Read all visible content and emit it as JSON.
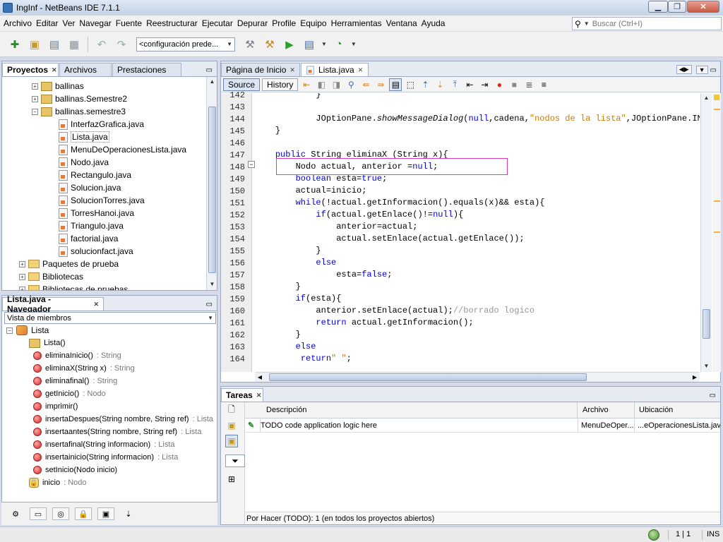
{
  "window": {
    "title": "IngInf - NetBeans IDE 7.1.1"
  },
  "menu": [
    "Archivo",
    "Editar",
    "Ver",
    "Navegar",
    "Fuente",
    "Reestructurar",
    "Ejecutar",
    "Depurar",
    "Profile",
    "Equipo",
    "Herramientas",
    "Ventana",
    "Ayuda"
  ],
  "search": {
    "placeholder": "Buscar (Ctrl+I)"
  },
  "toolbar": {
    "config": "<configuración prede..."
  },
  "projects": {
    "tabs": [
      "Proyectos",
      "Archivos",
      "Prestaciones"
    ],
    "tree": [
      "ballinas",
      "ballinas.Semestre2",
      "ballinas.semestre3",
      "InterfazGrafica.java",
      "Lista.java",
      "MenuDeOperacionesLista.java",
      "Nodo.java",
      "Rectangulo.java",
      "Solucion.java",
      "SolucionTorres.java",
      "TorresHanoi.java",
      "Triangulo.java",
      "factorial.java",
      "solucionfact.java",
      "Paquetes de prueba",
      "Bibliotecas",
      "Bibliotecas de pruebas"
    ]
  },
  "navigator": {
    "title": "Lista.java - Navegador",
    "filter": "Vista de miembros",
    "root": "Lista",
    "members": [
      {
        "name": "Lista()",
        "type": ""
      },
      {
        "name": "eliminaInicio()",
        "type": " : String"
      },
      {
        "name": "eliminaX(String x)",
        "type": " : String"
      },
      {
        "name": "eliminafinal()",
        "type": " : String"
      },
      {
        "name": "getInicio()",
        "type": " : Nodo"
      },
      {
        "name": "imprimir()",
        "type": ""
      },
      {
        "name": "insertaDespues(String nombre, String ref)",
        "type": " : Lista"
      },
      {
        "name": "insertaantes(String nombre, String ref)",
        "type": " : Lista"
      },
      {
        "name": "insertafinal(String informacion)",
        "type": " : Lista"
      },
      {
        "name": "insertainicio(String informacion)",
        "type": " : Lista"
      },
      {
        "name": "setInicio(Nodo inicio)",
        "type": ""
      },
      {
        "name": "inicio",
        "type": " : Nodo"
      }
    ]
  },
  "editor": {
    "tabs": [
      "Página de Inicio",
      "Lista.java"
    ],
    "modes": [
      "Source",
      "History"
    ],
    "line_numbers": [
      "142",
      "143",
      "144",
      "145",
      "146",
      "147",
      "148",
      "149",
      "150",
      "151",
      "152",
      "153",
      "154",
      "155",
      "156",
      "157",
      "158",
      "159",
      "160",
      "161",
      "162",
      "163",
      "164"
    ],
    "lines": [
      {
        "indent": "            ",
        "parts": [
          [
            "",
            "}"
          ]
        ]
      },
      {
        "indent": "",
        "parts": [
          [
            "",
            ""
          ]
        ]
      },
      {
        "indent": "            ",
        "parts": [
          [
            "",
            "JOptionPane."
          ],
          [
            "it",
            "showMessageDialog"
          ],
          [
            "",
            "("
          ],
          [
            "kw",
            "null"
          ],
          [
            "",
            ",cadena,"
          ],
          [
            "str",
            "\"nodos de la lista\""
          ],
          [
            "",
            ",JOptionPane.INFORMATION_MESSAGE);"
          ]
        ]
      },
      {
        "indent": "    ",
        "parts": [
          [
            "",
            "}"
          ]
        ]
      },
      {
        "indent": "",
        "parts": [
          [
            "",
            ""
          ]
        ]
      },
      {
        "indent": "    ",
        "parts": [
          [
            "kw",
            "public"
          ],
          [
            "",
            " String eliminaX (String x){"
          ]
        ]
      },
      {
        "indent": "        ",
        "parts": [
          [
            "",
            "Nodo actual, anterior ="
          ],
          [
            "kw",
            "null"
          ],
          [
            "",
            ";"
          ]
        ]
      },
      {
        "indent": "        ",
        "parts": [
          [
            "kw",
            "boolean"
          ],
          [
            "",
            " esta="
          ],
          [
            "kw",
            "true"
          ],
          [
            "",
            ";"
          ]
        ]
      },
      {
        "indent": "        ",
        "parts": [
          [
            "",
            "actual=inicio;"
          ]
        ]
      },
      {
        "indent": "        ",
        "parts": [
          [
            "kw",
            "while"
          ],
          [
            "",
            "(!actual.getInformacion().equals(x)&& esta){"
          ]
        ]
      },
      {
        "indent": "            ",
        "parts": [
          [
            "kw",
            "if"
          ],
          [
            "",
            "(actual.getEnlace()!="
          ],
          [
            "kw",
            "null"
          ],
          [
            "",
            "){"
          ]
        ]
      },
      {
        "indent": "                ",
        "parts": [
          [
            "",
            "anterior=actual;"
          ]
        ]
      },
      {
        "indent": "                ",
        "parts": [
          [
            "",
            "actual.setEnlace(actual.getEnlace());"
          ]
        ]
      },
      {
        "indent": "            ",
        "parts": [
          [
            "",
            "}"
          ]
        ]
      },
      {
        "indent": "            ",
        "parts": [
          [
            "kw",
            "else"
          ]
        ]
      },
      {
        "indent": "                ",
        "parts": [
          [
            "",
            "esta="
          ],
          [
            "kw",
            "false"
          ],
          [
            "",
            ";"
          ]
        ]
      },
      {
        "indent": "        ",
        "parts": [
          [
            "",
            "}"
          ]
        ]
      },
      {
        "indent": "        ",
        "parts": [
          [
            "kw",
            "if"
          ],
          [
            "",
            "(esta){"
          ]
        ]
      },
      {
        "indent": "            ",
        "parts": [
          [
            "",
            "anterior.setEnlace(actual);"
          ],
          [
            "cm",
            "//borrado logico"
          ]
        ]
      },
      {
        "indent": "            ",
        "parts": [
          [
            "kw",
            "return"
          ],
          [
            "",
            " actual.getInformacion();"
          ]
        ]
      },
      {
        "indent": "        ",
        "parts": [
          [
            "",
            "}"
          ]
        ]
      },
      {
        "indent": "        ",
        "parts": [
          [
            "kw",
            "else"
          ]
        ]
      },
      {
        "indent": "         ",
        "parts": [
          [
            "kw",
            "return"
          ],
          [
            "",
            ""
          ],
          [
            "str",
            "\" \""
          ],
          [
            "",
            ";"
          ]
        ]
      }
    ]
  },
  "tasks": {
    "title": "Tareas",
    "headers": [
      "Descripción",
      "Archivo",
      "Ubicación"
    ],
    "row": {
      "description": "TODO code application logic here",
      "file": "MenuDeOper...",
      "location": "...eOperacionesLista.java"
    },
    "status": "Por Hacer (TODO): 1  (en todos los proyectos abiertos)"
  },
  "statusbar": {
    "position": "1 | 1",
    "mode": "INS"
  }
}
